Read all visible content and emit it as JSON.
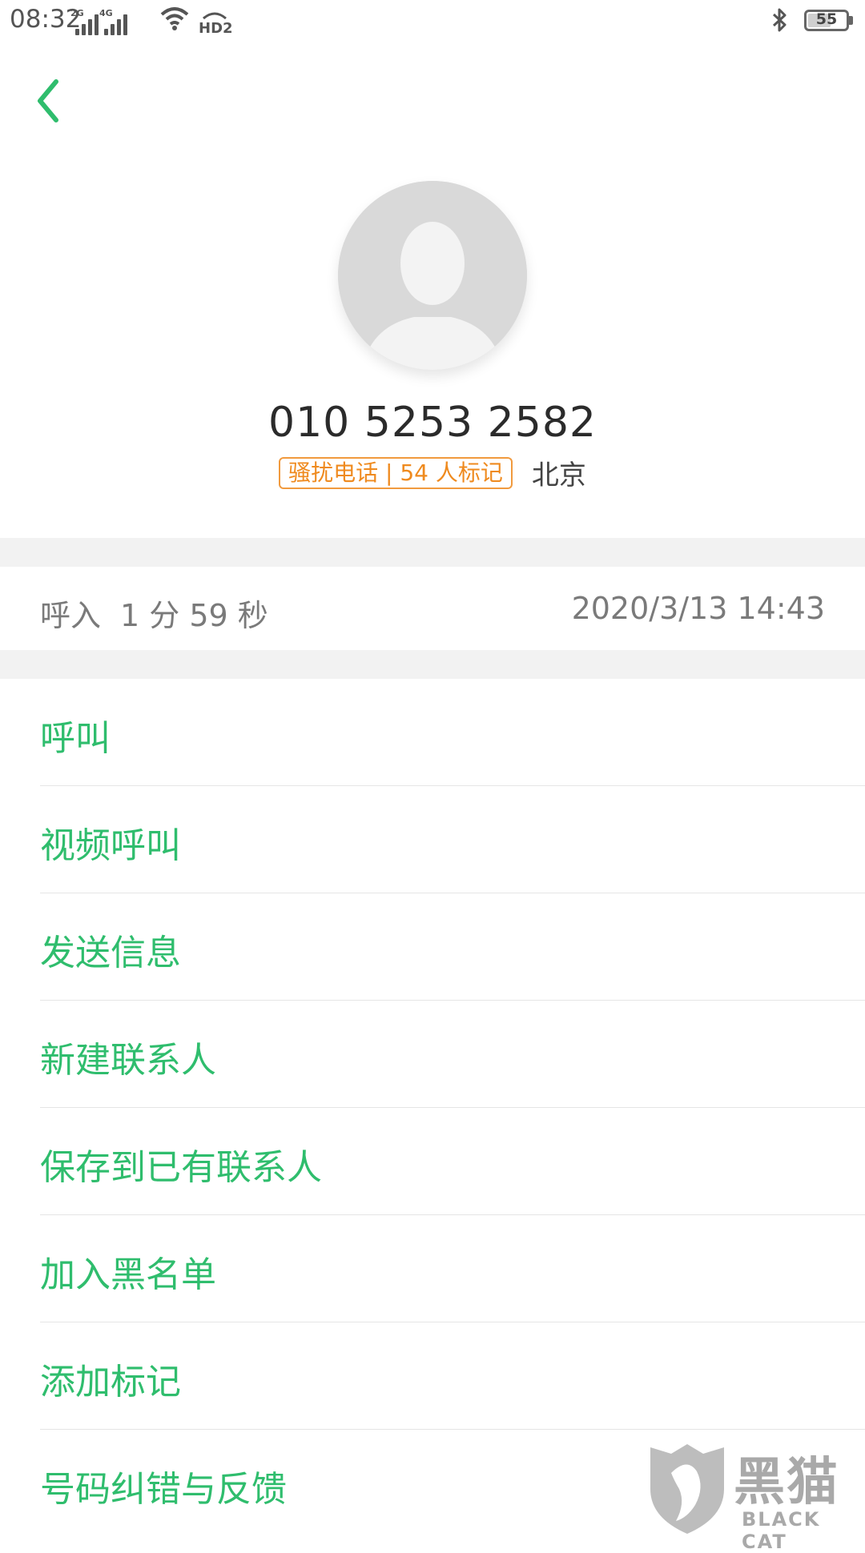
{
  "status_bar": {
    "time": "08:32",
    "signal1_label": "2G",
    "signal2_label": "4G",
    "volte_label": "HD2",
    "battery_level": "55",
    "icons": [
      "signal-icon",
      "wifi-icon",
      "hd-voice-icon",
      "bluetooth-icon",
      "battery-icon"
    ]
  },
  "header": {
    "back_icon": "chevron-left-icon"
  },
  "contact": {
    "avatar_icon": "default-avatar-icon",
    "number": "010 5253 2582",
    "tag": "骚扰电话 | 54 人标记",
    "location": "北京"
  },
  "call_log": {
    "type": "呼入",
    "duration": "1 分 59 秒",
    "datetime": "2020/3/13 14:43"
  },
  "actions": [
    {
      "label": "呼叫"
    },
    {
      "label": "视频呼叫"
    },
    {
      "label": "发送信息"
    },
    {
      "label": "新建联系人"
    },
    {
      "label": "保存到已有联系人"
    },
    {
      "label": "加入黑名单"
    },
    {
      "label": "添加标记"
    },
    {
      "label": "号码纠错与反馈"
    }
  ],
  "watermark": {
    "cn": "黑猫",
    "en": "BLACK CAT"
  },
  "colors": {
    "accent": "#2fbd6d",
    "tag": "#ef8a1e",
    "divider": "#e5e5e5",
    "section_bg": "#f2f2f2"
  }
}
